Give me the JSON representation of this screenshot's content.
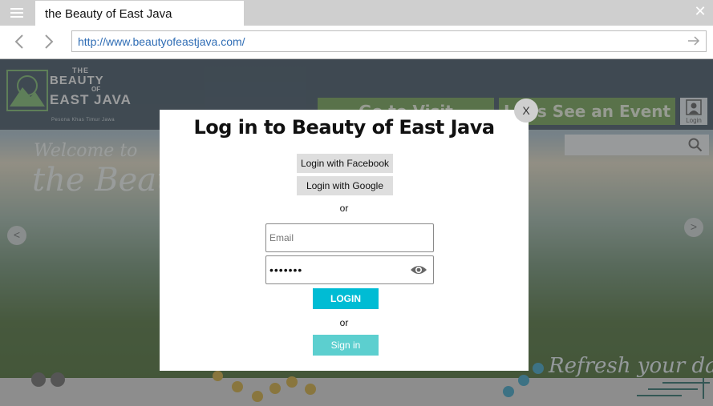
{
  "browser": {
    "tab_title": "the Beauty of East Java",
    "url": "http://www.beautyofeastjava.com/"
  },
  "site": {
    "logo": {
      "the": "THE",
      "beauty": "BEAUTY",
      "of": "OF",
      "east_java": "EAST JAVA",
      "tagline": "Pesona Khas Timur Jawa"
    },
    "menu": {
      "places_label": "Go to Visit",
      "events_label": "Let's See an Event"
    },
    "login_icon_label": "Login",
    "welcome_line1": "Welcome to",
    "welcome_line2": "the Beauty",
    "slide_prev": "<",
    "slide_next": ">",
    "slogan": "Refresh your day!"
  },
  "modal": {
    "title": "Log in to Beauty of East Java",
    "close_label": "X",
    "facebook_label": "Login with Facebook",
    "google_label": "Login with Google",
    "or_1": "or",
    "email_placeholder": "Email",
    "email_value": "",
    "password_value": "•••••••",
    "login_label": "LOGIN",
    "or_2": "or",
    "signin_label": "Sign in"
  },
  "colors": {
    "accent_login": "#00bcd4",
    "accent_signin": "#5ccfcf",
    "url_text": "#2f6db5",
    "header_bg": "#3d4f5e"
  }
}
